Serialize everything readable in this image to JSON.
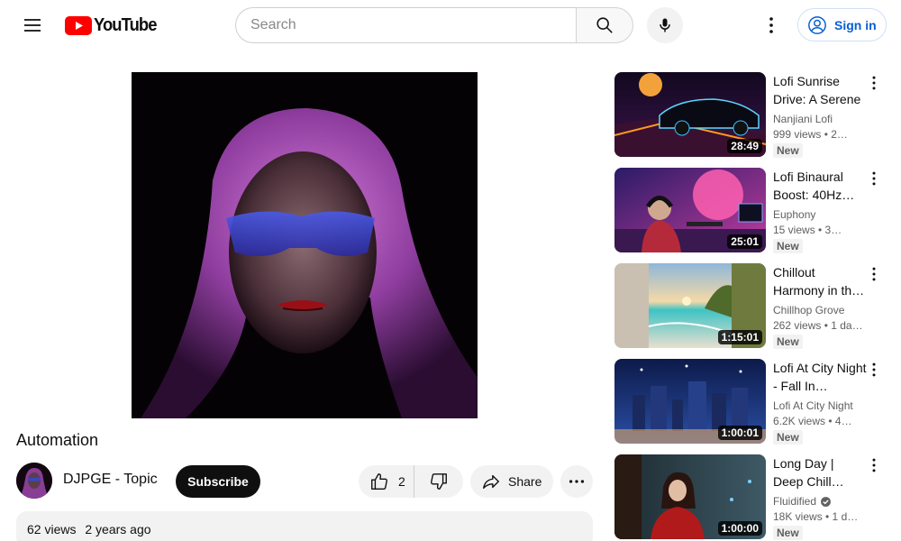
{
  "header": {
    "logo_text": "YouTube",
    "search_placeholder": "Search",
    "signin_label": "Sign in"
  },
  "video": {
    "title": "Automation",
    "channel": "DJPGE - Topic",
    "subscribe_label": "Subscribe",
    "likes": "2",
    "share_label": "Share",
    "views": "62 views",
    "age": "2 years ago"
  },
  "recommendations": [
    {
      "title": "Lofi Sunrise Drive: A Serene",
      "channel": "Nanjiani Lofi",
      "verified": false,
      "meta": "999 views • 2…",
      "badge": "New",
      "duration": "28:49"
    },
    {
      "title": "Lofi Binaural Boost: 40Hz…",
      "channel": "Euphony",
      "verified": false,
      "meta": "15 views • 3…",
      "badge": "New",
      "duration": "25:01"
    },
    {
      "title": "Chillout Harmony in th…",
      "channel": "Chillhop Grove",
      "verified": false,
      "meta": "262 views • 1 da…",
      "badge": "New",
      "duration": "1:15:01"
    },
    {
      "title": "Lofi At City Night - Fall In…",
      "channel": "Lofi At City Night",
      "verified": false,
      "meta": "6.2K views • 4…",
      "badge": "New",
      "duration": "1:00:01"
    },
    {
      "title": "Long Day | Deep Chill…",
      "channel": "Fluidified",
      "verified": true,
      "meta": "18K views • 1 d…",
      "badge": "New",
      "duration": "1:00:00"
    }
  ],
  "colors": {
    "brand_red": "#ff0000",
    "link_blue": "#065fd4",
    "chip_bg": "#f2f2f2"
  }
}
